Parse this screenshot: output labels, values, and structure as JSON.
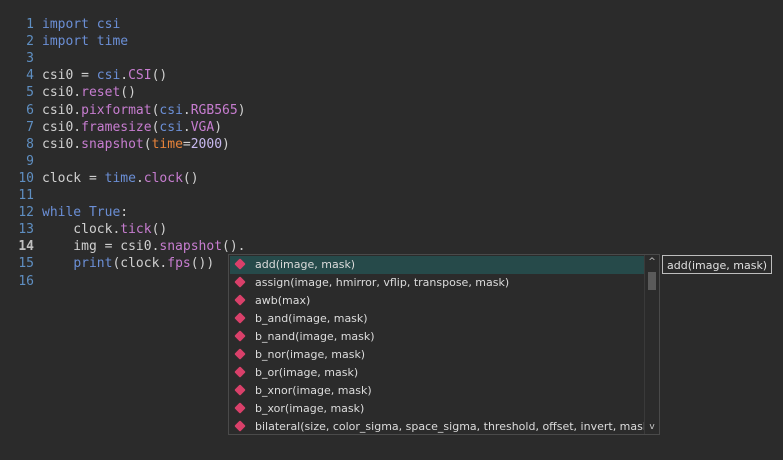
{
  "editor": {
    "lines": [
      {
        "n": "1",
        "parts": [
          [
            "kw",
            "import"
          ],
          [
            "plain",
            " "
          ],
          [
            "kw",
            "csi"
          ]
        ]
      },
      {
        "n": "2",
        "parts": [
          [
            "kw",
            "import"
          ],
          [
            "plain",
            " "
          ],
          [
            "kw",
            "time"
          ]
        ]
      },
      {
        "n": "3",
        "parts": []
      },
      {
        "n": "4",
        "parts": [
          [
            "plain",
            "csi0 = "
          ],
          [
            "kw",
            "csi"
          ],
          [
            "plain",
            "."
          ],
          [
            "cls",
            "CSI"
          ],
          [
            "plain",
            "()"
          ]
        ]
      },
      {
        "n": "5",
        "parts": [
          [
            "plain",
            "csi0."
          ],
          [
            "fn",
            "reset"
          ],
          [
            "plain",
            "()"
          ]
        ]
      },
      {
        "n": "6",
        "parts": [
          [
            "plain",
            "csi0."
          ],
          [
            "fn",
            "pixformat"
          ],
          [
            "plain",
            "("
          ],
          [
            "kw",
            "csi"
          ],
          [
            "plain",
            "."
          ],
          [
            "cls",
            "RGB565"
          ],
          [
            "plain",
            ")"
          ]
        ]
      },
      {
        "n": "7",
        "parts": [
          [
            "plain",
            "csi0."
          ],
          [
            "fn",
            "framesize"
          ],
          [
            "plain",
            "("
          ],
          [
            "kw",
            "csi"
          ],
          [
            "plain",
            "."
          ],
          [
            "cls",
            "VGA"
          ],
          [
            "plain",
            ")"
          ]
        ]
      },
      {
        "n": "8",
        "parts": [
          [
            "plain",
            "csi0."
          ],
          [
            "fn",
            "snapshot"
          ],
          [
            "plain",
            "("
          ],
          [
            "param",
            "time"
          ],
          [
            "plain",
            "="
          ],
          [
            "num",
            "2000"
          ],
          [
            "plain",
            ")"
          ]
        ]
      },
      {
        "n": "9",
        "parts": []
      },
      {
        "n": "10",
        "parts": [
          [
            "plain",
            "clock = "
          ],
          [
            "kw",
            "time"
          ],
          [
            "plain",
            "."
          ],
          [
            "fn",
            "clock"
          ],
          [
            "plain",
            "()"
          ]
        ]
      },
      {
        "n": "11",
        "parts": []
      },
      {
        "n": "12",
        "parts": [
          [
            "kw",
            "while"
          ],
          [
            "plain",
            " "
          ],
          [
            "kw",
            "True"
          ],
          [
            "plain",
            ":"
          ]
        ]
      },
      {
        "n": "13",
        "parts": [
          [
            "plain",
            "    clock."
          ],
          [
            "fn",
            "tick"
          ],
          [
            "plain",
            "()"
          ]
        ]
      },
      {
        "n": "14",
        "active": true,
        "parts": [
          [
            "plain",
            "    img = csi0."
          ],
          [
            "fn",
            "snapshot"
          ],
          [
            "plain",
            "()."
          ]
        ]
      },
      {
        "n": "15",
        "parts": [
          [
            "plain",
            "    "
          ],
          [
            "kw",
            "print"
          ],
          [
            "plain",
            "(clock."
          ],
          [
            "fn",
            "fps"
          ],
          [
            "plain",
            "())"
          ]
        ]
      },
      {
        "n": "16",
        "parts": []
      }
    ]
  },
  "autocomplete": {
    "items": [
      {
        "label": "add(image, mask)",
        "selected": true,
        "icon": "method-icon"
      },
      {
        "label": "assign(image, hmirror, vflip, transpose, mask)",
        "icon": "method-icon"
      },
      {
        "label": "awb(max)",
        "icon": "method-icon"
      },
      {
        "label": "b_and(image, mask)",
        "icon": "method-icon"
      },
      {
        "label": "b_nand(image, mask)",
        "icon": "method-icon"
      },
      {
        "label": "b_nor(image, mask)",
        "icon": "method-icon"
      },
      {
        "label": "b_or(image, mask)",
        "icon": "method-icon"
      },
      {
        "label": "b_xnor(image, mask)",
        "icon": "method-icon"
      },
      {
        "label": "b_xor(image, mask)",
        "icon": "method-icon"
      },
      {
        "label": "bilateral(size, color_sigma, space_sigma, threshold, offset, invert, mask)",
        "icon": "method-icon"
      }
    ],
    "scroll_up": "^",
    "scroll_down": "v"
  },
  "tooltip": {
    "text": "add(image, mask)"
  },
  "colors": {
    "background": "#2b2b2b",
    "keyword": "#6b8fd6",
    "function": "#c77dd0",
    "param": "#e8833a",
    "number": "#c8b9ef",
    "selection": "#264a4a",
    "method_icon": "#d9406a"
  }
}
